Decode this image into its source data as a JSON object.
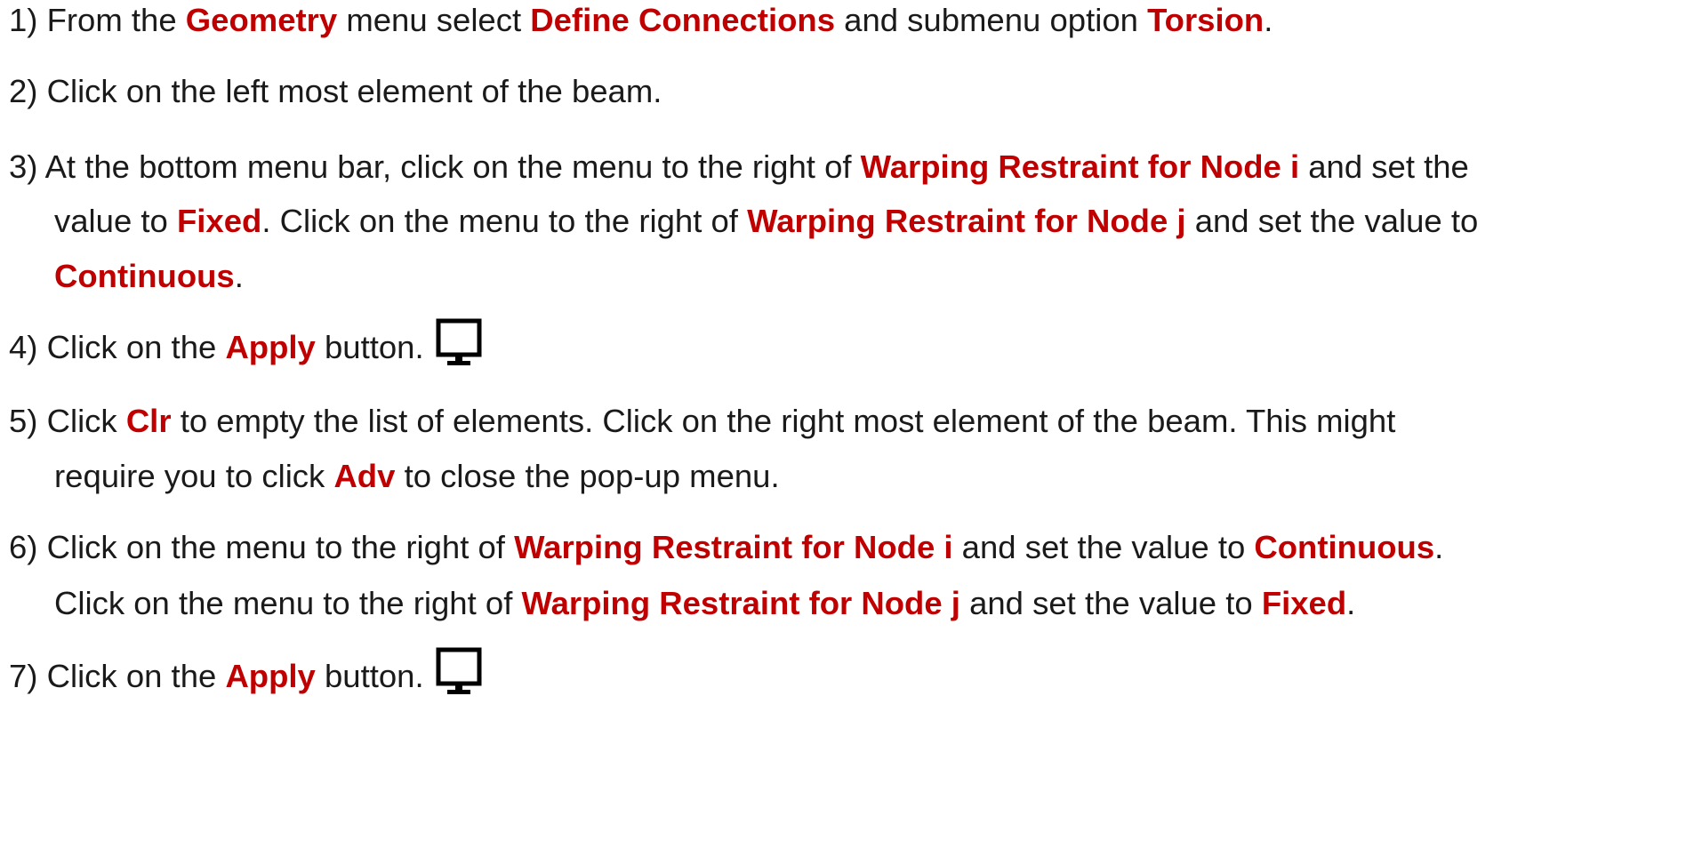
{
  "steps": [
    {
      "lines": [
        [
          {
            "t": "1) From the "
          },
          {
            "t": "Geometry",
            "hl": true
          },
          {
            "t": " menu select "
          },
          {
            "t": "Define Connections",
            "hl": true
          },
          {
            "t": " and submenu option "
          },
          {
            "t": "Torsion",
            "hl": true
          },
          {
            "t": "."
          }
        ]
      ]
    },
    {
      "lines": [
        [
          {
            "t": "2) Click on the left most element of the beam."
          }
        ]
      ]
    },
    {
      "lines": [
        [
          {
            "t": "3) At the bottom menu bar, click on the menu to the right of "
          },
          {
            "t": "Warping Restraint for Node i",
            "hl": true
          },
          {
            "t": " and set the"
          }
        ],
        [
          {
            "t": "value to "
          },
          {
            "t": "Fixed",
            "hl": true
          },
          {
            "t": ". Click on the menu to the right of "
          },
          {
            "t": "Warping Restraint for Node j",
            "hl": true
          },
          {
            "t": " and set the value to"
          }
        ],
        [
          {
            "t": "Continuous",
            "hl": true
          },
          {
            "t": "."
          }
        ]
      ]
    },
    {
      "icon": "monitor-icon",
      "lines": [
        [
          {
            "t": "4) Click on the "
          },
          {
            "t": "Apply",
            "hl": true
          },
          {
            "t": " button."
          }
        ]
      ]
    },
    {
      "lines": [
        [
          {
            "t": "5) Click "
          },
          {
            "t": "Clr",
            "hl": true
          },
          {
            "t": " to empty the list of elements. Click on the right most element of the beam. This might"
          }
        ],
        [
          {
            "t": "require you to click "
          },
          {
            "t": "Adv",
            "hl": true
          },
          {
            "t": " to close the pop-up menu."
          }
        ]
      ]
    },
    {
      "lines": [
        [
          {
            "t": "6) Click on the menu to the right of "
          },
          {
            "t": "Warping Restraint for Node i",
            "hl": true
          },
          {
            "t": " and set the value to "
          },
          {
            "t": "Continuous",
            "hl": true
          },
          {
            "t": "."
          }
        ],
        [
          {
            "t": "Click on the menu to the right of "
          },
          {
            "t": "Warping Restraint for Node j",
            "hl": true
          },
          {
            "t": " and set the value to "
          },
          {
            "t": "Fixed",
            "hl": true
          },
          {
            "t": "."
          }
        ]
      ]
    },
    {
      "icon": "monitor-icon",
      "lines": [
        [
          {
            "t": "7) Click on the "
          },
          {
            "t": "Apply",
            "hl": true
          },
          {
            "t": " button."
          }
        ]
      ]
    }
  ],
  "colors": {
    "text": "#1a1a1a",
    "highlight": "#c00000",
    "background": "#ffffff"
  }
}
